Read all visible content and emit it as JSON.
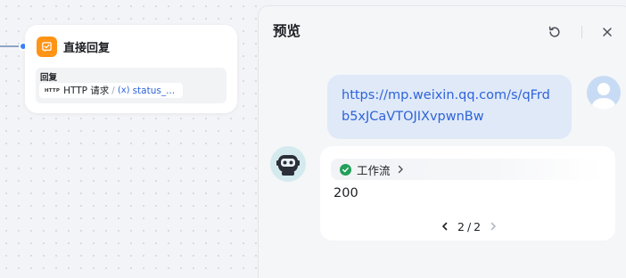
{
  "node": {
    "title": "直接回复",
    "field_label": "回复",
    "ref_tag": "HTTP",
    "ref_node": "HTTP 请求",
    "ref_separator": "/",
    "ref_var_icon": "(x)",
    "ref_var": "status_..."
  },
  "preview": {
    "title": "预览",
    "user_message": "https://mp.weixin.qq.com/s/qFrdb5xJCaVTOJIXvpwnBw",
    "workflow_tag": "工作流",
    "result": "200",
    "pager": {
      "current": "2",
      "total": "2"
    }
  },
  "icons": {
    "node": "reply-icon",
    "refresh": "refresh-icon",
    "close": "close-icon",
    "workflow_status": "check-circle-icon",
    "workflow_expand": "chevron-right-icon",
    "prev": "chevron-left-icon",
    "next": "chevron-right-icon"
  },
  "colors": {
    "node_accent": "#ff9417",
    "link": "#2e63d9",
    "user_bubble": "#dfe9f8",
    "success": "#22a05a",
    "connector": "#3b82f6"
  }
}
